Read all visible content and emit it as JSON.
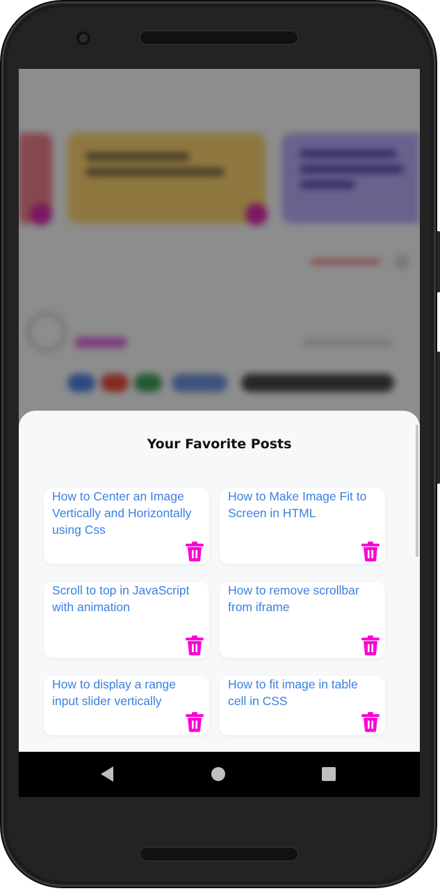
{
  "sheet": {
    "title": "Your Favorite Posts"
  },
  "favorites": [
    {
      "title": "How to Center an Image Vertically and Horizontally using Css",
      "delete_icon": "trash-icon"
    },
    {
      "title": "How to Make Image Fit to Screen in HTML",
      "delete_icon": "trash-icon"
    },
    {
      "title": "Scroll to top in JavaScript with animation",
      "delete_icon": "trash-icon"
    },
    {
      "title": "How to remove scrollbar from iframe",
      "delete_icon": "trash-icon"
    },
    {
      "title": "How to display a range input slider vertically",
      "delete_icon": "trash-icon"
    },
    {
      "title": "How to fit image in table cell in CSS",
      "delete_icon": "trash-icon"
    }
  ],
  "navbar": {
    "back_icon": "back-triangle-icon",
    "home_icon": "home-circle-icon",
    "recents_icon": "recents-square-icon"
  },
  "colors": {
    "link_text": "#3b7fe0",
    "trash_icon": "#ff00d4",
    "sheet_background": "#f7f8fa",
    "navbar": "#000000"
  }
}
